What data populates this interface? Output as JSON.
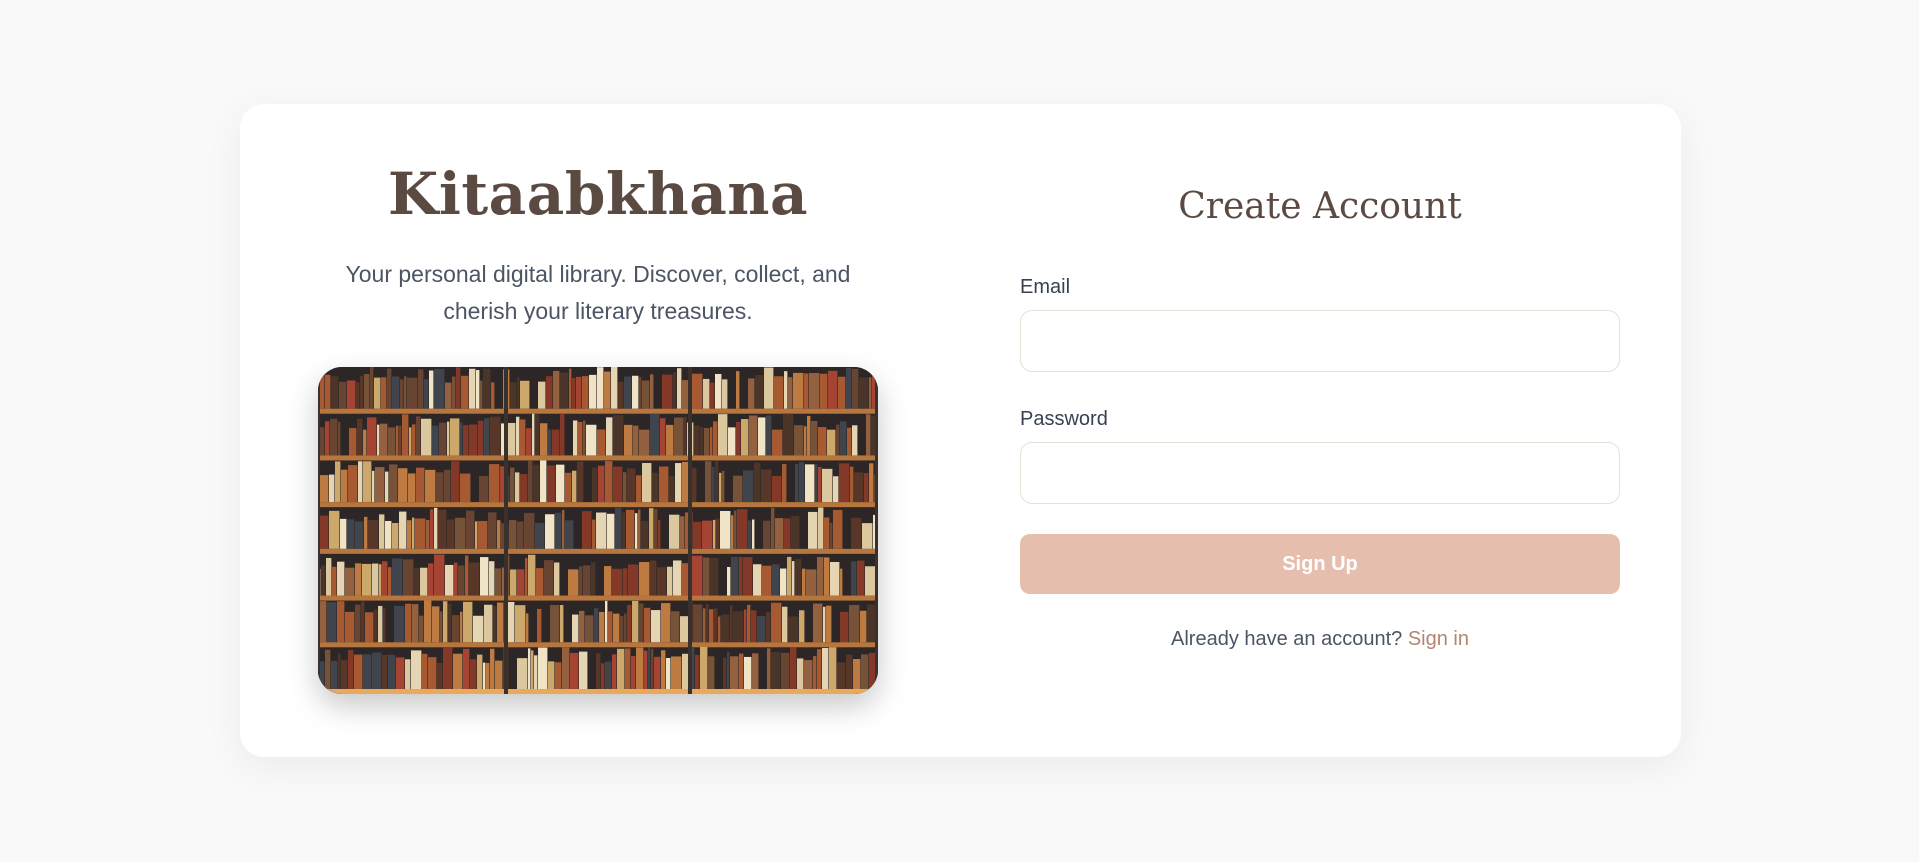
{
  "brand": {
    "name": "Kitaabkhana",
    "tagline": "Your personal digital library. Discover, collect, and cherish your literary treasures."
  },
  "hero_image": {
    "alt": "Library bookshelves"
  },
  "form": {
    "title": "Create Account",
    "email": {
      "label": "Email",
      "value": "",
      "placeholder": ""
    },
    "password": {
      "label": "Password",
      "value": "",
      "placeholder": ""
    },
    "submit_label": "Sign Up",
    "signin_prompt": "Already have an account?",
    "signin_link": "Sign in"
  },
  "colors": {
    "background": "#f9f9f9",
    "card": "#ffffff",
    "brand_text": "#5a4a42",
    "button": "#e6beae",
    "link": "#b08770"
  }
}
